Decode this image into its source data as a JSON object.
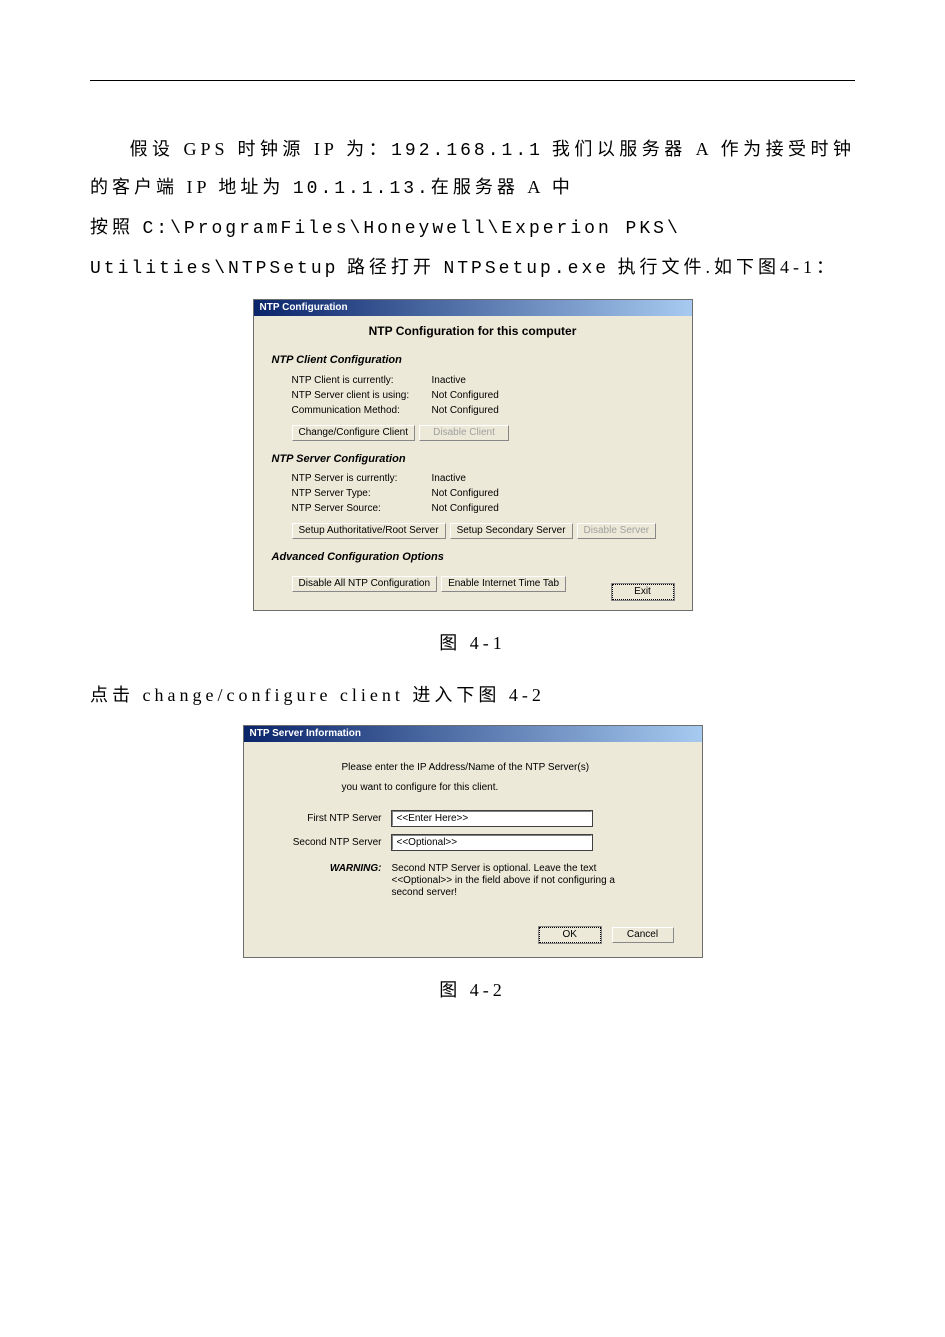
{
  "doc": {
    "para1_pre": "假设 GPS 时钟源 IP 为：",
    "para1_ip": "192.168.1.1",
    "para1_mid": "我们以服务器 A 作为接受时钟的客户端 IP 地址为 ",
    "para1_ip2": "10.1.1.13.",
    "para1_tail": "在服务器 A 中",
    "para2_pre": "按照 ",
    "para2_path1": "C:\\ProgramFiles\\Honeywell\\Experion PKS\\",
    "para2_path2": "Utilities\\NTPSetup",
    "para2_mid": " 路径打开 ",
    "para2_exe": "NTPSetup.exe",
    "para2_tail": " 执行文件.如下图4-1：",
    "caption1": "图 4-1",
    "para3": "点击 change/configure client 进入下图 4-2",
    "caption2": "图 4-2"
  },
  "dialog1": {
    "titlebar": "NTP Configuration",
    "heading": "NTP Configuration for this computer",
    "client_section": "NTP Client Configuration",
    "client_current_lbl": "NTP Client is currently:",
    "client_current_val": "Inactive",
    "client_using_lbl": "NTP Server client is using:",
    "client_using_val": "Not Configured",
    "client_comm_lbl": "Communication Method:",
    "client_comm_val": "Not Configured",
    "btn_change_client": "Change/Configure Client",
    "btn_disable_client": "Disable Client",
    "server_section": "NTP Server Configuration",
    "server_current_lbl": "NTP Server is currently:",
    "server_current_val": "Inactive",
    "server_type_lbl": "NTP Server Type:",
    "server_type_val": "Not Configured",
    "server_source_lbl": "NTP Server Source:",
    "server_source_val": "Not Configured",
    "btn_auth_root": "Setup Authoritative/Root Server",
    "btn_secondary": "Setup Secondary Server",
    "btn_disable_server": "Disable Server",
    "adv_section": "Advanced Configuration Options",
    "btn_disable_all": "Disable All NTP Configuration",
    "btn_enable_inet": "Enable Internet Time Tab",
    "btn_exit": "Exit"
  },
  "dialog2": {
    "titlebar": "NTP Server Information",
    "line1": "Please enter the IP Address/Name of the NTP Server(s)",
    "line2": "you want to configure for this client.",
    "first_lbl": "First NTP Server",
    "first_val": "<<Enter Here>>",
    "second_lbl": "Second NTP Server",
    "second_val": "<<Optional>>",
    "warn_lbl": "WARNING:",
    "warn_txt": "Second NTP Server is optional.  Leave the text <<Optional>> in the field above if not configuring a second server!",
    "btn_ok": "OK",
    "btn_cancel": "Cancel"
  }
}
